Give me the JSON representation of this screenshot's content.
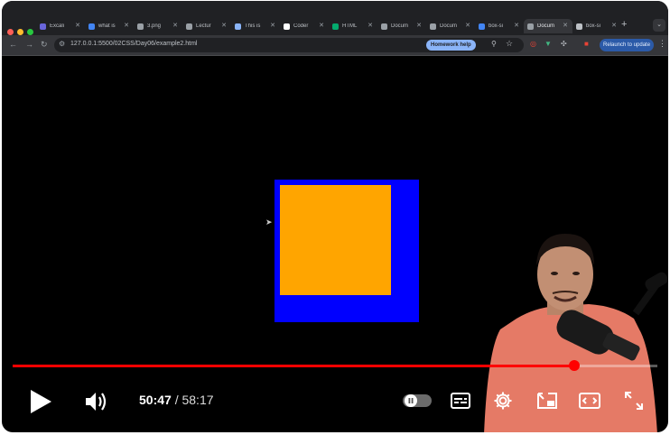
{
  "browser": {
    "tabs": [
      {
        "label": "Excali",
        "icon": "excalidraw-icon",
        "color": "#6965db"
      },
      {
        "label": "what is",
        "icon": "google-icon",
        "color": "#4285f4"
      },
      {
        "label": "3.png",
        "icon": "globe-icon",
        "color": "#9aa0a6"
      },
      {
        "label": "Lectur",
        "icon": "page-icon",
        "color": "#9aa0a6"
      },
      {
        "label": "This is",
        "icon": "diamond-icon",
        "color": "#8ab4f8"
      },
      {
        "label": "Coder",
        "icon": "coder-icon",
        "color": "#ffffff"
      },
      {
        "label": "HTML",
        "icon": "w3-icon",
        "color": "#04aa6d"
      },
      {
        "label": "Docum",
        "icon": "globe-icon",
        "color": "#9aa0a6"
      },
      {
        "label": "Docum",
        "icon": "globe-icon",
        "color": "#9aa0a6"
      },
      {
        "label": "box-si",
        "icon": "google-icon",
        "color": "#4285f4"
      },
      {
        "label": "Docum",
        "icon": "globe-icon",
        "color": "#9aa0a6"
      },
      {
        "label": "box-si",
        "icon": "ai-icon",
        "color": "#bdc1c6"
      }
    ],
    "active_tab_index": 10,
    "new_tab": "+",
    "url": "127.0.0.1:5500/02CSS/Day06/example2.html",
    "homework_help": "Homework help",
    "relaunch": "Relaunch to update"
  },
  "page": {
    "outer_box_color": "#0000ff",
    "inner_box_color": "#ffa500"
  },
  "player": {
    "current_time": "50:47",
    "separator": " / ",
    "total_time": "58:17",
    "progress_fraction": 0.871,
    "accent_color": "#ff0000",
    "controls": [
      "play-icon",
      "volume-icon",
      "autoplay-toggle",
      "subtitles-icon",
      "settings-icon",
      "miniplayer-icon",
      "theater-icon",
      "fullscreen-icon"
    ]
  }
}
